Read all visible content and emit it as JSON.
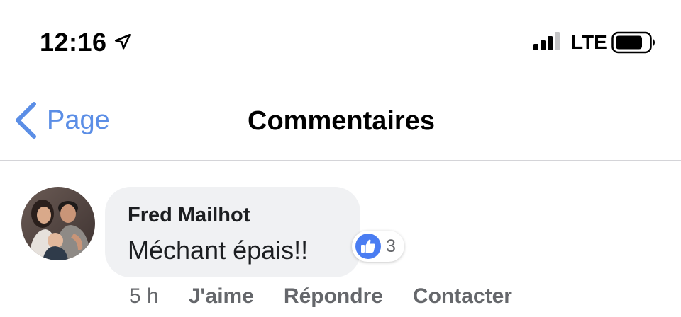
{
  "status_bar": {
    "time": "12:16",
    "location_icon": "location-arrow-icon",
    "signal_icon": "cellular-signal-icon",
    "network": "LTE",
    "battery_icon": "battery-icon"
  },
  "nav": {
    "back_icon": "chevron-left-icon",
    "back_label": "Page",
    "title": "Commentaires"
  },
  "comment": {
    "author": "Fred Mailhot",
    "text": "Méchant épais!!",
    "reaction_icon": "like-thumb-icon",
    "reaction_count": "3",
    "timestamp": "5 h",
    "actions": {
      "like": "J'aime",
      "reply": "Répondre",
      "contact": "Contacter"
    }
  },
  "colors": {
    "accent": "#5b8ee6",
    "like_blue": "#4a7df2",
    "bubble": "#f0f1f3",
    "secondary_text": "#65676b",
    "divider": "#d4d4d8"
  }
}
